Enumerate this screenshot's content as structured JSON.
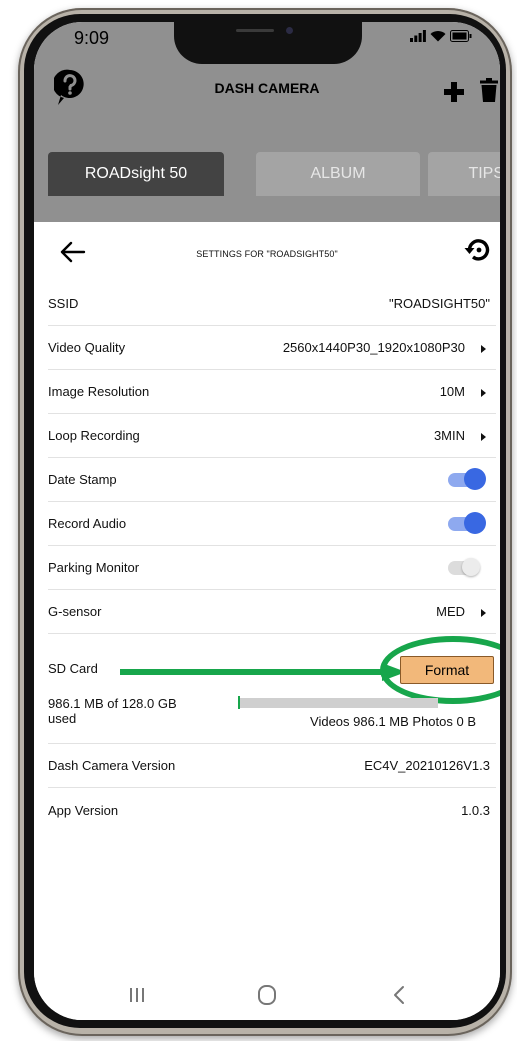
{
  "status": {
    "time": "9:09"
  },
  "header": {
    "title": "DASH CAMERA"
  },
  "tabs": [
    {
      "label": "ROADsight 50",
      "active": true
    },
    {
      "label": "ALBUM",
      "active": false
    },
    {
      "label": "TIPS",
      "active": false
    }
  ],
  "settings_title": "SETTINGS FOR \"ROADSIGHT50\"",
  "rows": {
    "ssid": {
      "label": "SSID",
      "value": "\"ROADSIGHT50\""
    },
    "video_quality": {
      "label": "Video Quality",
      "value": "2560x1440P30_1920x1080P30"
    },
    "image_resolution": {
      "label": "Image Resolution",
      "value": "10M"
    },
    "loop_recording": {
      "label": "Loop Recording",
      "value": "3MIN"
    },
    "date_stamp": {
      "label": "Date Stamp",
      "on": true
    },
    "record_audio": {
      "label": "Record Audio",
      "on": true
    },
    "parking_monitor": {
      "label": "Parking Monitor",
      "on": false
    },
    "g_sensor": {
      "label": "G-sensor",
      "value": "MED"
    },
    "sd_card": {
      "label": "SD Card",
      "button": "Format"
    },
    "dash_version": {
      "label": "Dash Camera Version",
      "value": "EC4V_20210126V1.3"
    },
    "app_version": {
      "label": "App Version",
      "value": "1.0.3"
    }
  },
  "storage": {
    "used_text": "986.1 MB of 128.0 GB used",
    "detail": "Videos 986.1 MB   Photos 0 B",
    "used_fraction": 0.0077
  },
  "colors": {
    "accent_blue": "#3968e2",
    "format_button": "#f2b87a",
    "annotation_green": "#17a64b",
    "header_gray": "#909090"
  },
  "icons": {
    "help": "help-icon",
    "add": "plus-icon",
    "delete": "trash-icon",
    "back": "back-arrow-icon",
    "reset": "reset-icon",
    "nav_recents": "recents-icon",
    "nav_home": "home-icon",
    "nav_back": "nav-back-icon"
  }
}
